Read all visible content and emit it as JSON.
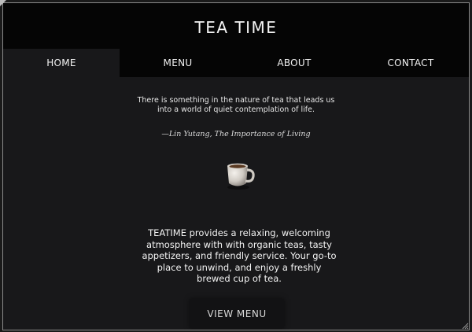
{
  "header": {
    "title": "TEA TIME"
  },
  "nav": {
    "items": [
      {
        "label": "HOME",
        "active": true
      },
      {
        "label": "MENU",
        "active": false
      },
      {
        "label": "ABOUT",
        "active": false
      },
      {
        "label": "CONTACT",
        "active": false
      }
    ]
  },
  "quote": {
    "line1": "There is something in the nature of tea that leads us",
    "line2": "into a world of quiet contemplation of life.",
    "attribution": "—Lin Yutang, The Importance of Living"
  },
  "icons": {
    "cup": "tea-cup-icon"
  },
  "description": {
    "text": "TEATIME provides a relaxing, welcoming atmosphere with with organic teas, tasty appetizers, and friendly service. Your go-to place to unwind, and enjoy a freshly brewed cup of tea."
  },
  "cta": {
    "label": "VIEW MENU"
  },
  "colors": {
    "header_bg": "#050505",
    "page_bg": "#18181a",
    "text": "#f3f3f3"
  }
}
